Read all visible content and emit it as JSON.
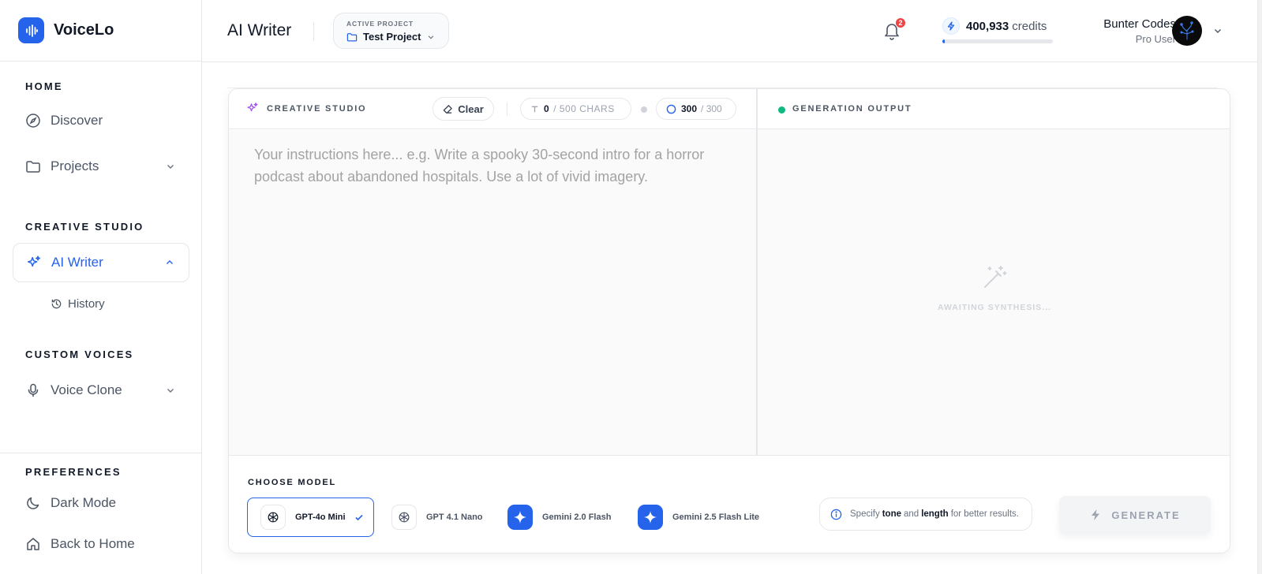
{
  "brand": {
    "name": "VoiceLo",
    "logo_icon": "waveform-icon",
    "accent": "#2563eb"
  },
  "sidebar": {
    "sections": {
      "home": "HOME",
      "creative_studio": "CREATIVE STUDIO",
      "custom_voices": "CUSTOM VOICES",
      "preferences": "PREFERENCES"
    },
    "items": {
      "discover": {
        "label": "Discover",
        "icon": "compass-icon"
      },
      "projects": {
        "label": "Projects",
        "icon": "folder-icon"
      },
      "ai_writer": {
        "label": "AI Writer",
        "icon": "sparkles-icon",
        "active": true
      },
      "history": {
        "label": "History",
        "icon": "history-icon"
      },
      "voice_clone": {
        "label": "Voice Clone",
        "icon": "microphone-icon"
      },
      "dark_mode": {
        "label": "Dark Mode",
        "icon": "moon-icon"
      },
      "back_home": {
        "label": "Back to Home",
        "icon": "home-icon"
      }
    }
  },
  "header": {
    "title": "AI Writer",
    "project": {
      "kicker": "ACTIVE PROJECT",
      "name": "Test Project"
    },
    "notifications": {
      "count": "2"
    },
    "credits": {
      "amount": "400,933",
      "unit": "credits",
      "fill_fraction": 0.02
    },
    "user": {
      "name": "Bunter Codes",
      "role": "Pro User"
    }
  },
  "studio": {
    "label": "CREATIVE STUDIO",
    "clear_label": "Clear",
    "chars": {
      "count": "0",
      "suffix": "/ 500 CHARS"
    },
    "limit": {
      "count": "300",
      "suffix": "/ 300"
    },
    "prompt": {
      "value": "",
      "placeholder": "Your instructions here... e.g. Write a spooky 30-second intro for a horror podcast about abandoned hospitals. Use a lot of vivid imagery."
    }
  },
  "output": {
    "label": "GENERATION OUTPUT",
    "status_color": "#10b981",
    "empty_text": "AWAITING SYNTHESIS..."
  },
  "models": {
    "label": "CHOOSE MODEL",
    "selected": "GPT-4o Mini",
    "options": [
      {
        "label": "GPT-4o Mini",
        "icon": "openai-icon"
      },
      {
        "label": "GPT 4.1 Nano",
        "icon": "openai-icon"
      },
      {
        "label": "Gemini 2.0 Flash",
        "icon": "gemini-icon"
      },
      {
        "label": "Gemini 2.5 Flash Lite",
        "icon": "gemini-icon"
      }
    ]
  },
  "tip": {
    "prefix": "Specify",
    "word1": "tone",
    "and": "and",
    "word2": "length",
    "suffix": "for better results."
  },
  "generate_label": "GENERATE"
}
